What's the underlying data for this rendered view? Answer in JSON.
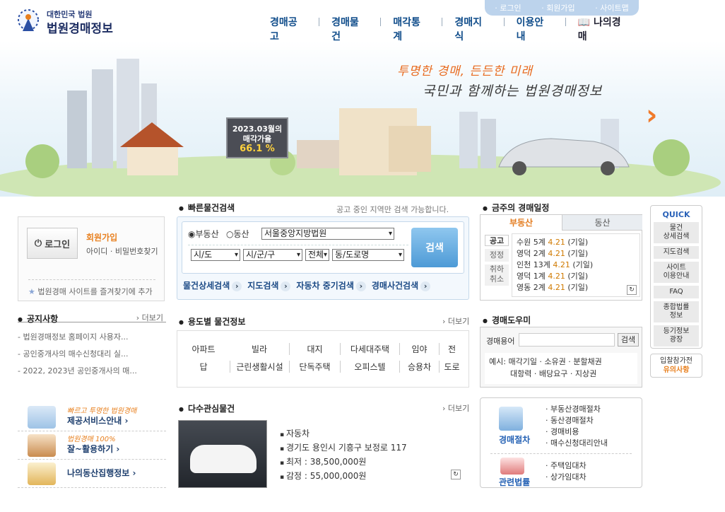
{
  "top_links": [
    "로그인",
    "회원가입",
    "사이트맵"
  ],
  "logo": {
    "small": "대한민국 법원",
    "big": "법원경매정보"
  },
  "gnb": [
    "경매공고",
    "경매물건",
    "매각통계",
    "경매지식",
    "이용안내",
    "나의경매"
  ],
  "banner": {
    "slogan1": "투명한 경매, 든든한 미래",
    "slogan2": "국민과 함께하는 법원경매정보",
    "board_line1": "2023.03월의",
    "board_line2": "매각가율",
    "board_rate": "66.1 %"
  },
  "login": {
    "button": "로그인",
    "join": "회원가입",
    "find": "아이디 · 비밀번호찾기",
    "favorite": "법원경매 사이트를 즐겨찾기에 추가"
  },
  "quick_search": {
    "title": "빠른물건검색",
    "note": "공고 중인 지역만 검색 가능합니다.",
    "radio1": "부동산",
    "radio2": "동산",
    "court": "서울중앙지방법원",
    "sido": "시/도",
    "sigungu": "시/군/구",
    "jeon": "전체",
    "dong": "동/도로명",
    "search": "검색",
    "links": [
      "물건상세검색",
      "지도검색",
      "자동차 중기검색",
      "경매사건검색"
    ]
  },
  "schedule": {
    "title": "금주의 경매일정",
    "tab1": "부동산",
    "tab2": "동산",
    "side": [
      "공고",
      "정정",
      "취하\n취소"
    ],
    "items": [
      {
        "court": "수원",
        "no": "5계",
        "date": "4.21",
        "type": "(기일)"
      },
      {
        "court": "영덕",
        "no": "2계",
        "date": "4.21",
        "type": "(기일)"
      },
      {
        "court": "인천",
        "no": "13계",
        "date": "4.21",
        "type": "(기일)"
      },
      {
        "court": "영덕",
        "no": "1계",
        "date": "4.21",
        "type": "(기일)"
      },
      {
        "court": "영동",
        "no": "2계",
        "date": "4.21",
        "type": "(기일)"
      }
    ]
  },
  "quick": {
    "title": "QUICK",
    "items": [
      "물건\n상세검색",
      "지도검색",
      "사이트\n이용안내",
      "FAQ",
      "종합법률\n정보",
      "등기정보\n광장"
    ]
  },
  "notice_q": {
    "line1": "입찰참가전",
    "line2": "유의사항"
  },
  "notices": {
    "title": "공지사항",
    "more": "더보기",
    "items": [
      "법원경매정보 홈페이지 사용자...",
      "공인중개사의 매수신청대리 실...",
      "2022, 2023년 공인중개사의 매..."
    ]
  },
  "usage": {
    "title": "용도별 물건정보",
    "more": "더보기",
    "row1": [
      "아파트",
      "빌라",
      "대지",
      "다세대주택",
      "임야",
      "전"
    ],
    "row2": [
      "답",
      "근린생활시설",
      "단독주택",
      "오피스텔",
      "승용차",
      "도로"
    ]
  },
  "dict": {
    "title": "경매도우미",
    "label": "경매용어",
    "button": "검색",
    "ex_label": "예시:",
    "ex1": [
      "매각기일",
      "소유권",
      "분할채권"
    ],
    "ex2": [
      "대항력",
      "배당요구",
      "지상권"
    ]
  },
  "popular": {
    "title": "다수관심물건",
    "more": "더보기",
    "lines": [
      "자동차",
      "경기도 용인시 기흥구 보정로 117",
      "최저 : 38,500,000원",
      "감정 : 55,000,000원"
    ]
  },
  "left_banners": [
    {
      "t1": "빠르고 투명한 법원경매",
      "t2": "제공서비스안내 ›"
    },
    {
      "t1": "법원경매 100%",
      "t2": "잘~활용하기 ›"
    },
    {
      "t1": "",
      "t2": "나의동산집행정보 ›"
    }
  ],
  "procedure": {
    "h1": "경매절차",
    "items1": [
      "부동산경매절차",
      "동산경매절차",
      "경매비용",
      "매수신청대리안내"
    ],
    "h2": "관련법률",
    "items2": [
      "주택임대차",
      "상가임대차"
    ]
  },
  "colors": {
    "accent": "#e8801f",
    "nav": "#0f4c8a",
    "search_btn": "#4d9ad6"
  }
}
